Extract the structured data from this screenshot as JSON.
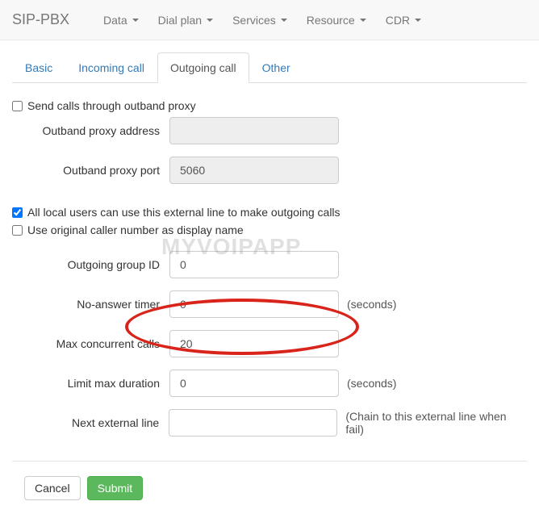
{
  "navbar": {
    "brand": "SIP-PBX",
    "items": [
      "Data",
      "Dial plan",
      "Services",
      "Resource",
      "CDR"
    ]
  },
  "tabs": [
    "Basic",
    "Incoming call",
    "Outgoing call",
    "Other"
  ],
  "checkboxes": {
    "outband_proxy": "Send calls through outband proxy",
    "all_local": "All local users can use this external line to make outgoing calls",
    "original_caller": "Use original caller number as display name"
  },
  "fields": {
    "outband_addr": {
      "label": "Outband proxy address",
      "value": ""
    },
    "outband_port": {
      "label": "Outband proxy port",
      "value": "5060"
    },
    "group_id": {
      "label": "Outgoing group ID",
      "value": "0"
    },
    "no_answer": {
      "label": "No-answer timer",
      "value": "0",
      "suffix": "(seconds)"
    },
    "max_concurrent": {
      "label": "Max concurrent calls",
      "value": "20"
    },
    "limit_duration": {
      "label": "Limit max duration",
      "value": "0",
      "suffix": "(seconds)"
    },
    "next_line": {
      "label": "Next external line",
      "value": "",
      "suffix": "(Chain to this external line when fail)"
    }
  },
  "buttons": {
    "cancel": "Cancel",
    "submit": "Submit"
  },
  "watermark": "MYVOIPAPP"
}
